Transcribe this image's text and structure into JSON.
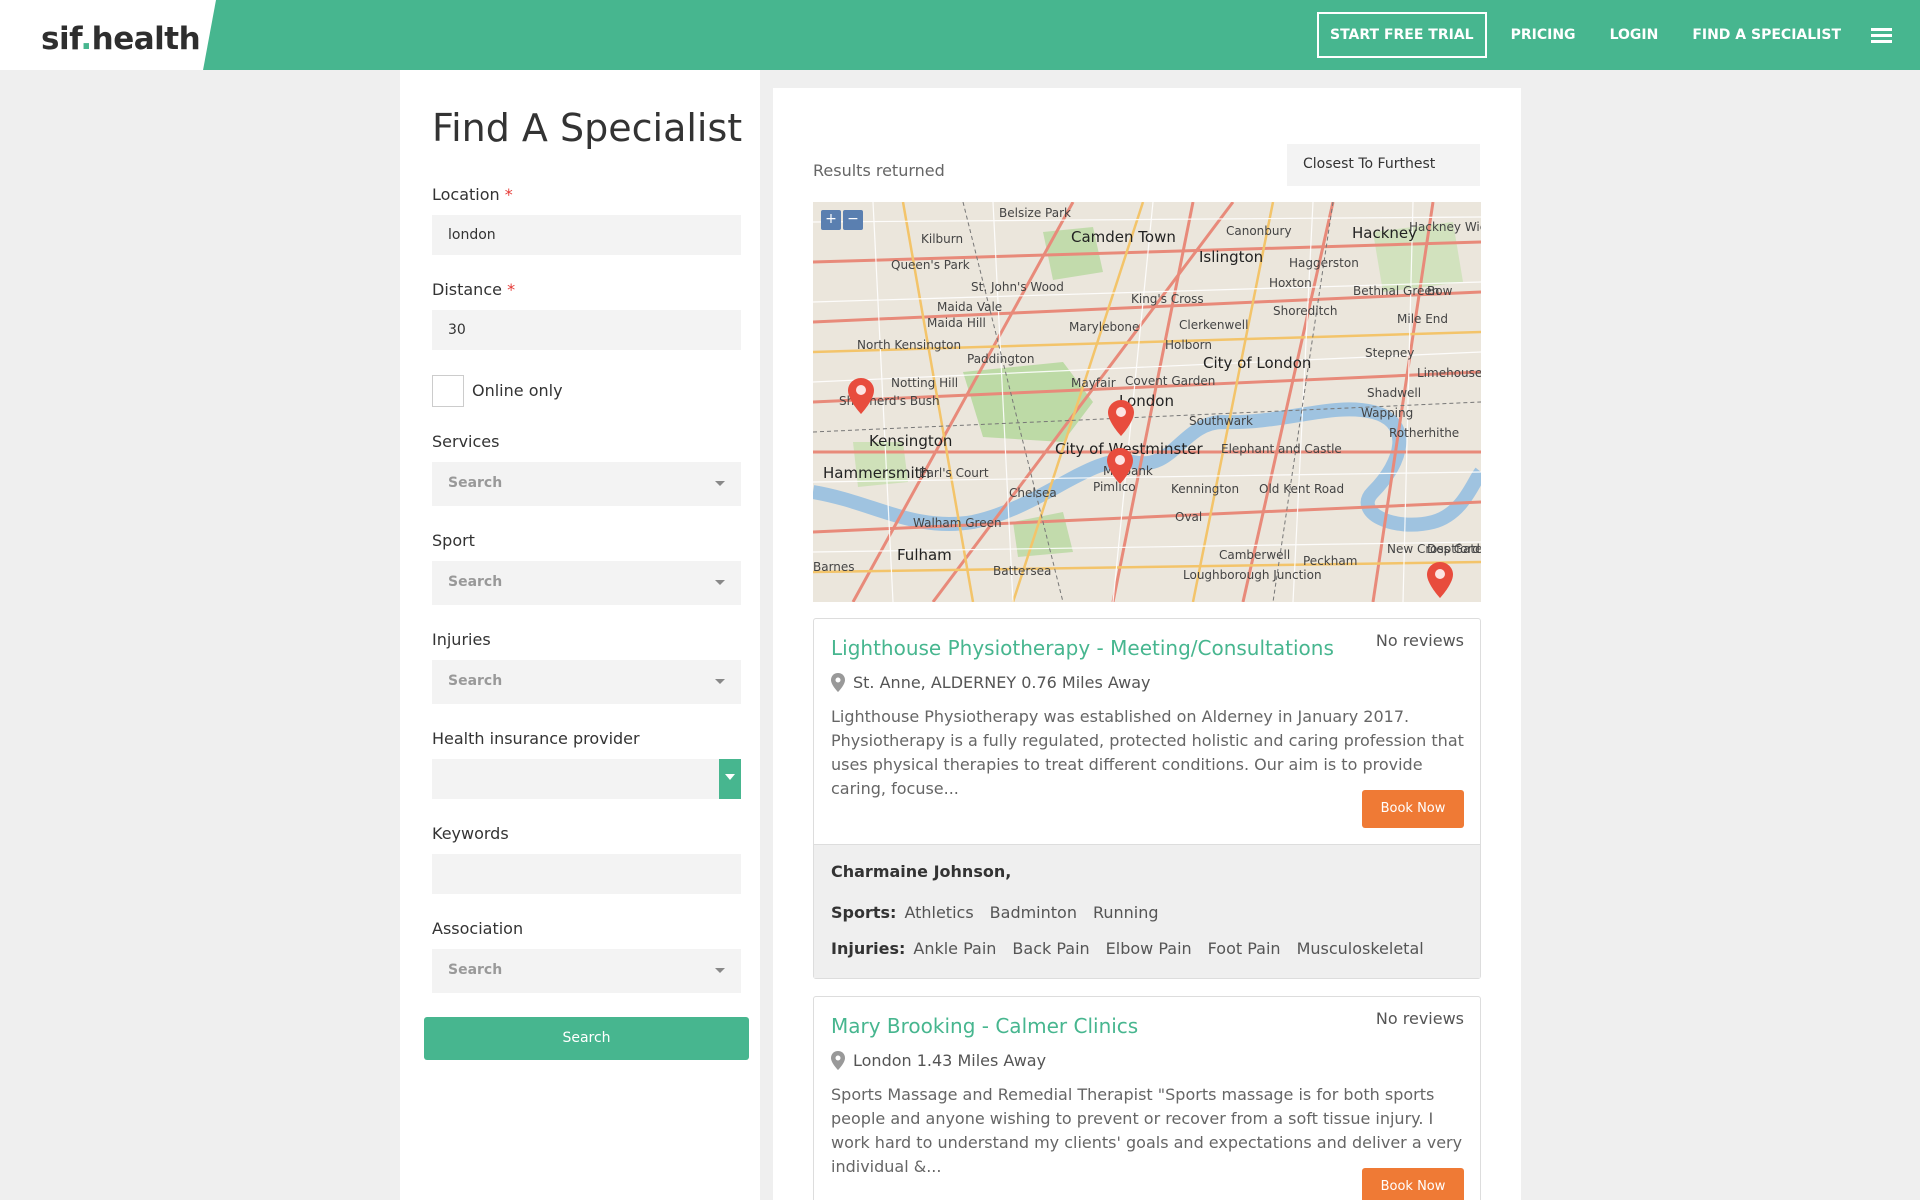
{
  "header": {
    "logo_main": "sif",
    "logo_dot": ".",
    "logo_rest": "health",
    "nav": {
      "trial": "START FREE TRIAL",
      "pricing": "PRICING",
      "login": "LOGIN",
      "find": "FIND A SPECIALIST"
    },
    "brand_color": "#47b68f"
  },
  "search_form": {
    "title": "Find A Specialist",
    "location_label": "Location",
    "location_value": "london",
    "distance_label": "Distance",
    "distance_value": "30",
    "required_mark": "*",
    "online_label": "Online only",
    "online_checked": false,
    "services_label": "Services",
    "services_placeholder": "Search",
    "sport_label": "Sport",
    "sport_placeholder": "Search",
    "injuries_label": "Injuries",
    "injuries_placeholder": "Search",
    "insurance_label": "Health insurance provider",
    "insurance_value": "",
    "keywords_label": "Keywords",
    "keywords_value": "",
    "association_label": "Association",
    "association_placeholder": "Search",
    "search_button": "Search"
  },
  "results": {
    "label": "Results returned",
    "sort_value": "Closest To Furthest",
    "map": {
      "zoom_in": "+",
      "zoom_out": "−",
      "labels": [
        "Kilburn",
        "Belsize Park",
        "Camden Town",
        "Canonbury",
        "Hackney",
        "Hackney Wick",
        "Queen's Park",
        "Islington",
        "Haggerston",
        "St. John's Wood",
        "King's Cross",
        "Hoxton",
        "Bethnal Green",
        "Bow",
        "Maida Vale",
        "Marylebone",
        "Clerkenwell",
        "Shoreditch",
        "Mile End",
        "Maida Hill",
        "North Kensington",
        "Holborn",
        "Paddington",
        "City of London",
        "Stepney",
        "Limehouse",
        "Notting Hill",
        "Mayfair",
        "Covent Garden",
        "Shadwell",
        "Shepherd's Bush",
        "London",
        "Wapping",
        "Kensington",
        "Southwark",
        "Rotherhithe",
        "City of Westminster",
        "Elephant and Castle",
        "Hammersmith",
        "Earl's Court",
        "Millbank",
        "Chelsea",
        "Pimlico",
        "Kennington",
        "Old Kent Road",
        "Oval",
        "Walham Green",
        "Fulham",
        "Battersea",
        "Camberwell",
        "Peckham",
        "New Cross Gate",
        "Deptford",
        "Loughborough Junction",
        "Barnes"
      ]
    },
    "cards": [
      {
        "title": "Lighthouse Physiotherapy - Meeting/Consultations",
        "reviews": "No reviews",
        "location": "St. Anne, ALDERNEY 0.76 Miles Away",
        "description": "Lighthouse Physiotherapy was established on Alderney in January 2017. Physiotherapy is a fully regulated, protected holistic and caring profession that uses physical therapies to treat different conditions. Our aim is to provide caring, focuse...",
        "book_label": "Book Now",
        "practitioner": "Charmaine Johnson,",
        "sports_label": "Sports:",
        "sports": [
          "Athletics",
          "Badminton",
          "Running"
        ],
        "injuries_label": "Injuries:",
        "injuries": [
          "Ankle Pain",
          "Back Pain",
          "Elbow Pain",
          "Foot Pain",
          "Musculoskeletal"
        ]
      },
      {
        "title": "Mary Brooking - Calmer Clinics",
        "reviews": "No reviews",
        "location": "London 1.43 Miles Away",
        "description": "Sports Massage and Remedial Therapist \"Sports massage is for both sports people and anyone wishing to prevent or recover from a soft tissue injury. I work hard to understand my clients' goals and expectations and deliver a very individual &...",
        "book_label": "Book Now"
      }
    ]
  },
  "colors": {
    "accent": "#47b68f",
    "book": "#ef7a35",
    "required": "#e53935",
    "pin": "#e84c3d"
  }
}
